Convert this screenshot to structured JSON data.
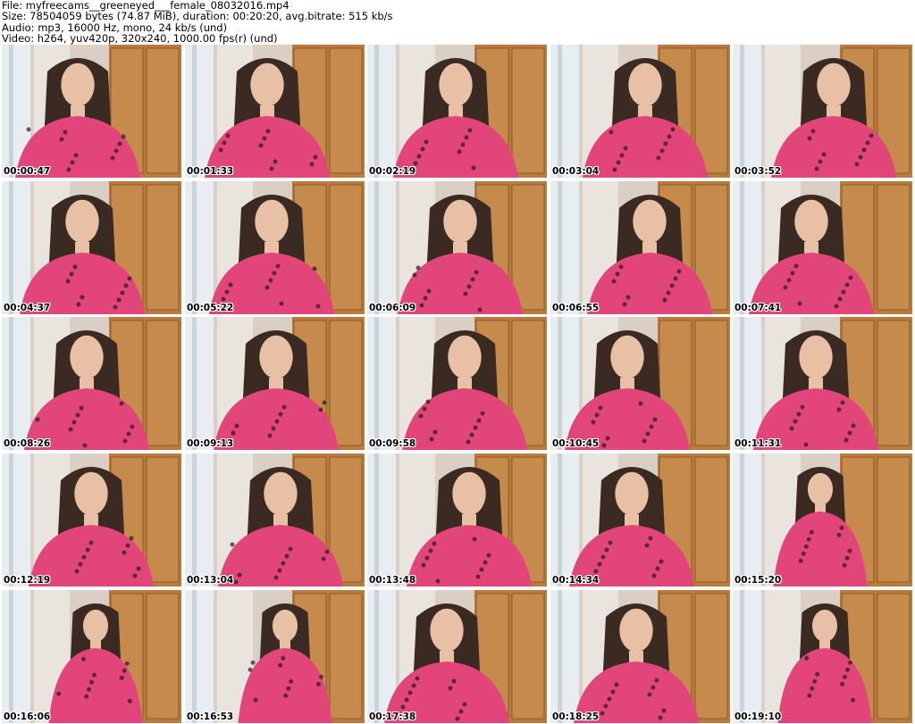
{
  "header": {
    "file_line": "File: myfreecams__greeneyed___female_08032016.mp4",
    "size_line": "Size: 78504059 bytes (74.87 MiB), duration: 00:20:20, avg.bitrate: 515 kb/s",
    "audio_line": "Audio: mp3, 16000 Hz, mono, 24 kb/s (und)",
    "video_line": "Video: h264, yuv420p, 320x240, 1000.00 fps(r) (und)"
  },
  "thumbnails": [
    {
      "timestamp": "00:00:47"
    },
    {
      "timestamp": "00:01:33"
    },
    {
      "timestamp": "00:02:19"
    },
    {
      "timestamp": "00:03:04"
    },
    {
      "timestamp": "00:03:52"
    },
    {
      "timestamp": "00:04:37"
    },
    {
      "timestamp": "00:05:22"
    },
    {
      "timestamp": "00:06:09"
    },
    {
      "timestamp": "00:06:55"
    },
    {
      "timestamp": "00:07:41"
    },
    {
      "timestamp": "00:08:26"
    },
    {
      "timestamp": "00:09:13"
    },
    {
      "timestamp": "00:09:58"
    },
    {
      "timestamp": "00:10:45"
    },
    {
      "timestamp": "00:11:31"
    },
    {
      "timestamp": "00:12:19"
    },
    {
      "timestamp": "00:13:04"
    },
    {
      "timestamp": "00:13:48"
    },
    {
      "timestamp": "00:14:34"
    },
    {
      "timestamp": "00:15:20"
    },
    {
      "timestamp": "00:16:06"
    },
    {
      "timestamp": "00:16:53"
    },
    {
      "timestamp": "00:17:38"
    },
    {
      "timestamp": "00:18:25"
    },
    {
      "timestamp": "00:19:10"
    }
  ],
  "colors": {
    "wall": "#d9cfc4",
    "wardrobe": "#b97b3e",
    "curtain": "#e8edf1",
    "shirt": "#e2457a",
    "hair": "#3b2a22",
    "skin": "#e7c0a6"
  }
}
